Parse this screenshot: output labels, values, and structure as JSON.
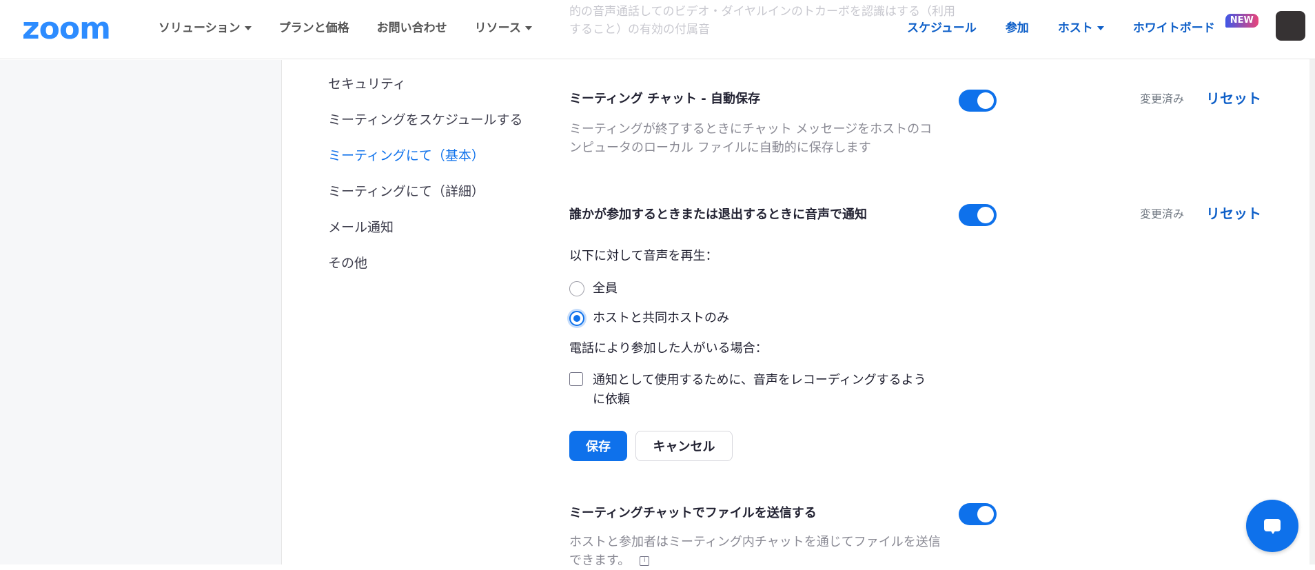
{
  "header": {
    "logo": "zoom",
    "nav_left": [
      "ソリューション",
      "プランと価格",
      "お問い合わせ",
      "リソース"
    ],
    "nav_right": {
      "schedule": "スケジュール",
      "join": "参加",
      "host": "ホスト",
      "whiteboard": "ホワイトボード",
      "new_badge": "NEW"
    }
  },
  "faded_overlay_text": "的の音声通話してのビデオ・ダイヤルインのトカーボを認識はする（利用すること）の有効の付属音",
  "sidebar": {
    "items": [
      {
        "label": "セキュリティ"
      },
      {
        "label": "ミーティングをスケジュールする"
      },
      {
        "label": "ミーティングにて（基本）"
      },
      {
        "label": "ミーティングにて（詳細）"
      },
      {
        "label": "メール通知"
      },
      {
        "label": "その他"
      }
    ]
  },
  "settings": {
    "chat_autosave": {
      "title": "ミーティング チャット - 自動保存",
      "desc": "ミーティングが終了するときにチャット メッセージをホストのコンピュータのローカル ファイルに自動的に保存します",
      "modified": "変更済み",
      "reset": "リセット",
      "enabled": true
    },
    "join_leave_sound": {
      "title": "誰かが参加するときまたは退出するときに音声で通知",
      "modified": "変更済み",
      "reset": "リセット",
      "enabled": true,
      "play_for_label": "以下に対して音声を再生：",
      "option_all": "全員",
      "option_host_only": "ホストと共同ホストのみ",
      "selected": "ホストと共同ホストのみ",
      "phone_label": "電話により参加した人がいる場合：",
      "record_label": "通知として使用するために、音声をレコーディングするように依頼",
      "record_checked": false,
      "save": "保存",
      "cancel": "キャンセル"
    },
    "file_transfer": {
      "title": "ミーティングチャットでファイルを送信する",
      "desc": "ホストと参加者はミーティング内チャットを通じてファイルを送信できます。",
      "enabled": true
    }
  },
  "colors": {
    "accent": "#0e71eb",
    "link": "#0e5fc8",
    "logo": "#2d8cff"
  }
}
